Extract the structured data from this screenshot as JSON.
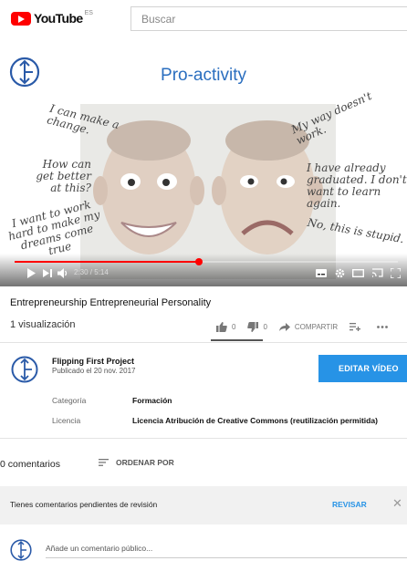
{
  "header": {
    "logo_text": "YouTube",
    "region": "ES",
    "search_placeholder": "Buscar"
  },
  "video": {
    "overlay_title": "Pro-activity",
    "quotes_left": [
      "I can make a change.",
      "How can get better at this?",
      "I want to work hard to make my dreams come true"
    ],
    "quotes_right": [
      "My way doesn't work.",
      "I have already graduated. I don't want to learn again.",
      "No, this is stupid."
    ],
    "time_display": "2:30 / 5:14",
    "progress": 0.48
  },
  "info": {
    "title": "Entrepreneurship Entrepreneurial Personality",
    "views": "1 visualización",
    "likes": "0",
    "dislikes": "0",
    "share_label": "COMPARTIR"
  },
  "owner": {
    "name": "Flipping First Project",
    "published": "Publicado el 20 nov. 2017",
    "edit_label": "EDITAR VÍDEO"
  },
  "metadata": [
    {
      "key": "Categoría",
      "value": "Formación"
    },
    {
      "key": "Licencia",
      "value": "Licencia Atribución de Creative Commons (reutilización permitida)"
    }
  ],
  "comments": {
    "count_label": "0 comentarios",
    "sort_label": "ORDENAR POR",
    "pending_text": "Tienes comentarios pendientes de revisión",
    "review_label": "REVISAR",
    "input_placeholder": "Añade un comentario público..."
  },
  "colors": {
    "brand_red": "#ff0000",
    "accent_blue": "#2793e6",
    "title_blue": "#2a6ebf"
  }
}
